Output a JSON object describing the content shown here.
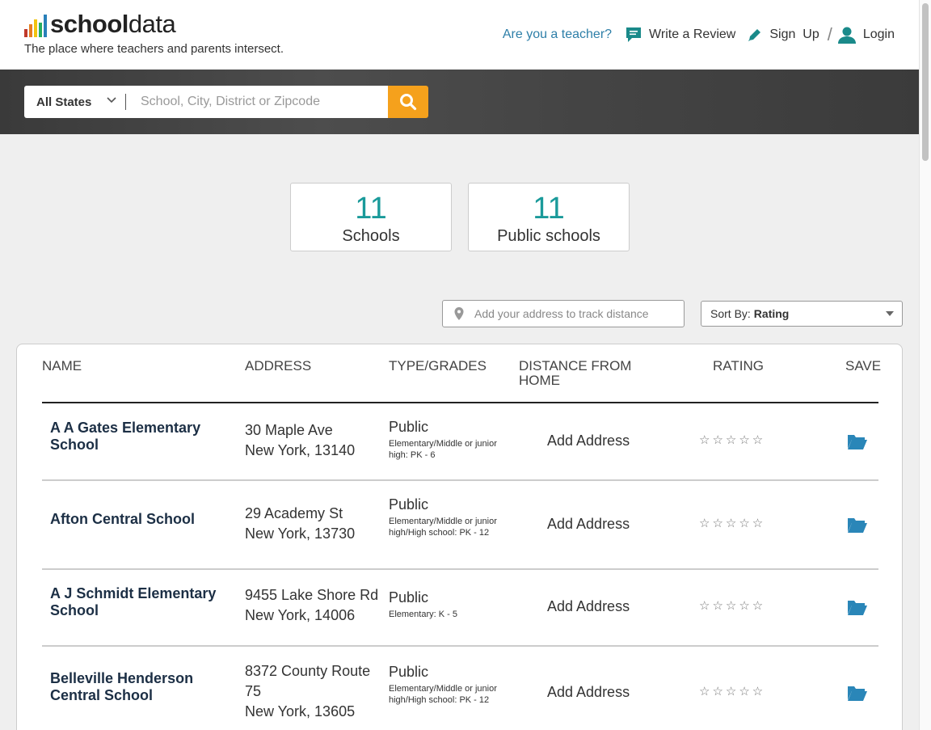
{
  "brand": {
    "logo_bold": "school",
    "logo_light": "data",
    "tagline": "The place where teachers and parents intersect.",
    "bar_colors": [
      "#c0392b",
      "#e67e22",
      "#f1c40f",
      "#27ae60",
      "#2980b9",
      "#34495e"
    ]
  },
  "topnav": {
    "teacher_link": "Are you a teacher?",
    "write_review": "Write a Review",
    "signup": "Sign  Up",
    "slash": "/",
    "login": "Login"
  },
  "search": {
    "state": "All States",
    "placeholder": "School, City, District or Zipcode"
  },
  "stats": [
    {
      "num": "11",
      "label": "Schools"
    },
    {
      "num": "11",
      "label": "Public schools"
    }
  ],
  "filters": {
    "address_placeholder": "Add your address to track distance",
    "sort_prefix": "Sort By:",
    "sort_value": "Rating"
  },
  "table": {
    "headers": {
      "name": "NAME",
      "address": "ADDRESS",
      "type": "TYPE/GRADES",
      "distance": "DISTANCE FROM HOME",
      "rating": "RATING",
      "save": "SAVE"
    },
    "rows": [
      {
        "name": "A A Gates Elementary School",
        "address1": "30 Maple Ave",
        "address2": "New York, 13140",
        "type": "Public",
        "grades": "Elementary/Middle or junior high: PK - 6",
        "distance": "Add Address",
        "stars": "☆☆☆☆☆"
      },
      {
        "name": "Afton Central School",
        "address1": "29 Academy St",
        "address2": "New York, 13730",
        "type": "Public",
        "grades": "Elementary/Middle or junior high/High school: PK - 12",
        "distance": "Add Address",
        "stars": "☆☆☆☆☆"
      },
      {
        "name": "A J Schmidt Elementary School",
        "address1": "9455 Lake Shore Rd",
        "address2": "New York, 14006",
        "type": "Public",
        "grades": "Elementary: K - 5",
        "distance": "Add Address",
        "stars": "☆☆☆☆☆"
      },
      {
        "name": "Belleville Henderson Central School",
        "address1": "8372 County Route 75",
        "address2": "New York, 13605",
        "type": "Public",
        "grades": "Elementary/Middle or junior high/High school: PK - 12",
        "distance": "Add Address",
        "stars": "☆☆☆☆☆"
      }
    ]
  },
  "colors": {
    "accent_teal": "#1a9a9a",
    "link_blue": "#2e7fa8",
    "search_orange": "#f5a11c",
    "folder_blue": "#2a86b8"
  }
}
